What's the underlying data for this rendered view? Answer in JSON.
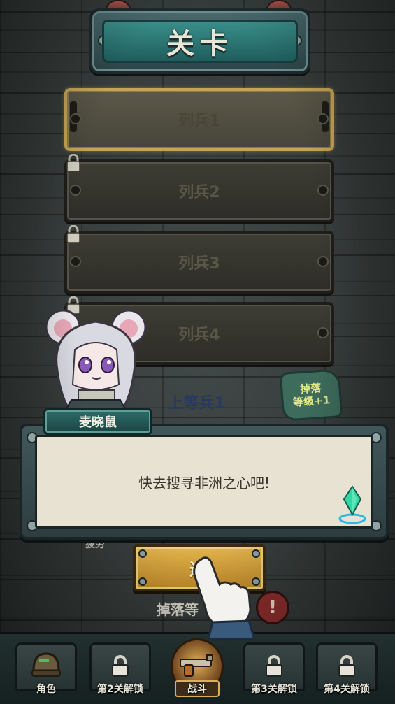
{
  "title": "关卡",
  "levels": [
    {
      "label": "列兵1",
      "locked": false,
      "selected": true
    },
    {
      "label": "列兵2",
      "locked": true,
      "selected": false
    },
    {
      "label": "列兵3",
      "locked": true,
      "selected": false
    },
    {
      "label": "列兵4",
      "locked": true,
      "selected": false
    },
    {
      "label": "上等兵1",
      "locked": true,
      "selected": false
    }
  ],
  "drop_badge": {
    "line1": "掉落",
    "line2": "等级+1"
  },
  "speaker": {
    "name": "麦晓鼠"
  },
  "dialog": {
    "text": "快去搜寻非洲之心吧!"
  },
  "fatigue_label": "疲劳",
  "enter_button": {
    "label": "进"
  },
  "drop_level_label": "掉落等",
  "alert": {
    "symbol": "!"
  },
  "nav": [
    {
      "label": "角色",
      "icon": "helmet-icon"
    },
    {
      "label": "第2关解锁",
      "icon": "lock-icon"
    },
    {
      "label": "战斗",
      "icon": "gun-icon",
      "active": true
    },
    {
      "label": "第3关解锁",
      "icon": "lock-icon"
    },
    {
      "label": "第4关解锁",
      "icon": "lock-icon"
    }
  ]
}
